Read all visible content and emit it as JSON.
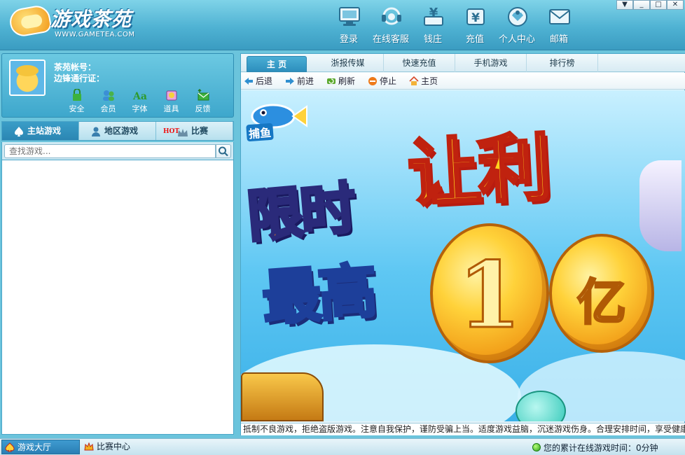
{
  "header": {
    "logo_text": "游戏茶苑",
    "logo_url_text": "WWW.GAMETEA.COM",
    "nav": [
      {
        "label": "登录",
        "icon": "monitor-icon"
      },
      {
        "label": "在线客服",
        "icon": "headset-icon"
      },
      {
        "label": "钱庄",
        "icon": "bank-icon"
      },
      {
        "label": "充值",
        "icon": "recharge-icon"
      },
      {
        "label": "个人中心",
        "icon": "user-center-icon"
      },
      {
        "label": "邮箱",
        "icon": "mail-icon"
      }
    ],
    "window_buttons": [
      "▼",
      "_",
      "□",
      "✕"
    ]
  },
  "user": {
    "account_label": "茶苑帐号：",
    "pass_label": "边锋通行证：",
    "tools": [
      {
        "label": "安全",
        "icon": "lock-icon"
      },
      {
        "label": "会员",
        "icon": "members-icon"
      },
      {
        "label": "字体",
        "icon": "font-icon"
      },
      {
        "label": "道具",
        "icon": "props-icon"
      },
      {
        "label": "反馈",
        "icon": "feedback-icon"
      }
    ]
  },
  "game_tabs": [
    {
      "label": "主站游戏",
      "icon": "spade-icon"
    },
    {
      "label": "地区游戏",
      "icon": "person-icon"
    },
    {
      "label": "比赛",
      "icon": "crown-icon",
      "badge": "HOT"
    }
  ],
  "search": {
    "placeholder": "查找游戏..."
  },
  "page_tabs": [
    "主 页",
    "浙报传媒",
    "快速充值",
    "手机游戏",
    "排行榜"
  ],
  "browser_buttons": [
    {
      "label": "后退",
      "icon": "back-arrow-icon"
    },
    {
      "label": "前进",
      "icon": "forward-arrow-icon"
    },
    {
      "label": "刷新",
      "icon": "refresh-icon"
    },
    {
      "label": "停止",
      "icon": "stop-icon"
    },
    {
      "label": "主页",
      "icon": "home-icon"
    }
  ],
  "banner": {
    "game_name": "捕鱼",
    "line1": "限时",
    "line2": "让利",
    "line3": "最高",
    "coin1": "1",
    "coin2": "亿"
  },
  "ticker": "抵制不良游戏，拒绝盗版游戏。注意自我保护，谨防受骗上当。适度游戏益脑，沉迷游戏伤身。合理安排时间，享受健康生活。",
  "statusbar": {
    "tabs": [
      {
        "label": "游戏大厅",
        "icon": "hall-icon"
      },
      {
        "label": "比赛中心",
        "icon": "match-center-icon"
      }
    ],
    "online_time": "您的累计在线游戏时间：0分钟"
  },
  "colors": {
    "accent": "#2d8fbd",
    "header": "#4fb2d3"
  }
}
